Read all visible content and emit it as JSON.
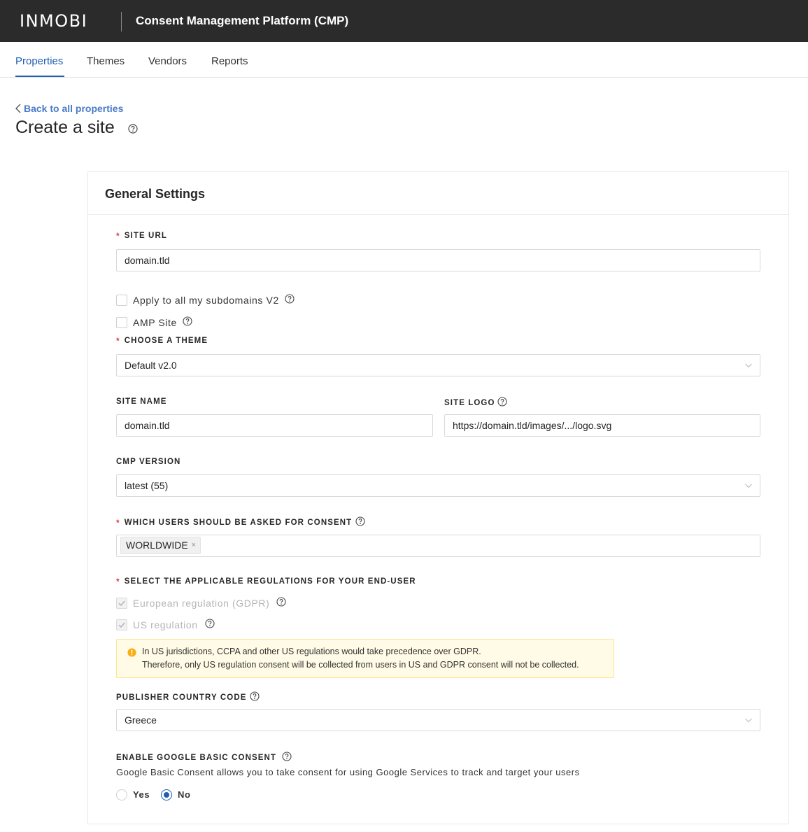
{
  "header": {
    "logo_text": "INMOBI",
    "app_title": "Consent Management Platform (CMP)"
  },
  "tabs": [
    {
      "label": "Properties",
      "active": true
    },
    {
      "label": "Themes",
      "active": false
    },
    {
      "label": "Vendors",
      "active": false
    },
    {
      "label": "Reports",
      "active": false
    }
  ],
  "page": {
    "back_link": "Back to all properties",
    "title": "Create a site"
  },
  "card": {
    "title": "General Settings"
  },
  "form": {
    "required_mark": "*",
    "site_url": {
      "label": "SITE URL",
      "value": "domain.tld"
    },
    "subdomains": {
      "label": "Apply to all my subdomains V2",
      "checked": false
    },
    "amp_site": {
      "label": "AMP Site",
      "checked": false
    },
    "theme": {
      "label": "CHOOSE A THEME",
      "value": "Default v2.0"
    },
    "site_name": {
      "label": "SITE NAME",
      "value": "domain.tld"
    },
    "site_logo": {
      "label": "SITE LOGO",
      "value": "https://domain.tld/images/.../logo.svg"
    },
    "cmp_version": {
      "label": "CMP VERSION",
      "value": "latest (55)"
    },
    "consent_users": {
      "label": "WHICH USERS SHOULD BE ASKED FOR CONSENT",
      "tags": [
        "WORLDWIDE"
      ],
      "tag_remove": "×"
    },
    "regulations": {
      "label": "SELECT THE APPLICABLE REGULATIONS FOR YOUR END-USER",
      "options": [
        {
          "label": "European regulation (GDPR)",
          "checked": true,
          "disabled": true
        },
        {
          "label": "US regulation",
          "checked": true,
          "disabled": true
        }
      ]
    },
    "alert": {
      "line1": "In US jurisdictions, CCPA and other US regulations would take precedence over GDPR.",
      "line2": "Therefore, only US regulation consent will be collected from users in US and GDPR consent will not be collected."
    },
    "country_code": {
      "label": "PUBLISHER COUNTRY CODE",
      "value": "Greece"
    },
    "google_consent": {
      "label": "ENABLE GOOGLE BASIC CONSENT",
      "description": "Google Basic Consent allows you to take consent for using Google Services to track and target your users",
      "options": [
        {
          "label": "Yes",
          "checked": false
        },
        {
          "label": "No",
          "checked": true
        }
      ]
    }
  },
  "colors": {
    "topbar": "#2b2b2b",
    "accent": "#1e5fb3",
    "required": "#e03a3a",
    "alert_bg": "#fffbe6",
    "alert_border": "#ffe58f",
    "warning_icon": "#faad14"
  }
}
